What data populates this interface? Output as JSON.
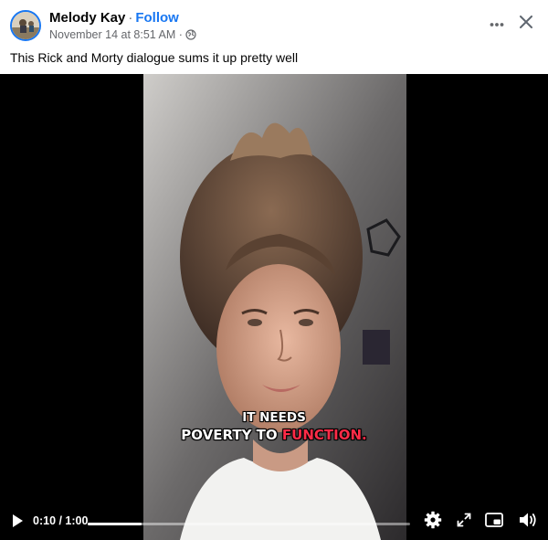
{
  "post": {
    "author": "Melody Kay",
    "separator": "·",
    "follow_label": "Follow",
    "timestamp": "November 14 at 8:51 AM",
    "meta_separator": "·",
    "audience_icon": "globe-icon",
    "more_icon": "more-horizontal-icon",
    "close_icon": "close-icon",
    "caption": "This Rick and Morty dialogue sums it up pretty well"
  },
  "video": {
    "subtitle_line1": "IT NEEDS",
    "subtitle_line2_plain": "POVERTY TO ",
    "subtitle_line2_highlight": "FUNCTION.",
    "highlight_color": "#ff2b47",
    "controls": {
      "play_icon": "play-icon",
      "current_time": "0:10",
      "duration": "1:00",
      "time_display": "0:10 / 1:00",
      "progress_fraction": 0.167,
      "settings_icon": "gear-icon",
      "fullscreen_icon": "expand-icon",
      "pip_icon": "picture-in-picture-icon",
      "volume_icon": "volume-icon"
    }
  },
  "colors": {
    "accent": "#1877f2",
    "text_primary": "#050505",
    "text_secondary": "#65676b"
  }
}
